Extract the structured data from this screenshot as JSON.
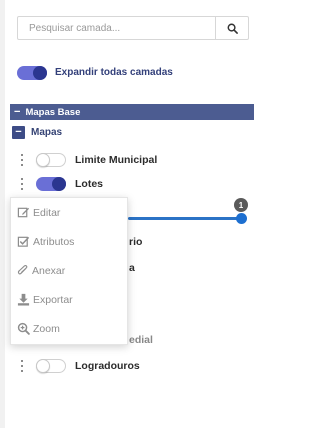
{
  "search": {
    "placeholder": "Pesquisar camada..."
  },
  "expand_all": {
    "label": "Expandir todas camadas",
    "state": "on"
  },
  "group": {
    "title": "Mapas Base",
    "toggle_symbol": "−"
  },
  "subgroup": {
    "title": "Mapas",
    "toggle_symbol": "−"
  },
  "layers": [
    {
      "label": "Limite Municipal",
      "visible": false
    },
    {
      "label": "Lotes",
      "visible": true
    },
    {
      "label": "rio",
      "visible": false
    },
    {
      "label": "a",
      "visible": false
    },
    {
      "label": "edial",
      "visible": false
    },
    {
      "label": "Logradouros",
      "visible": false
    }
  ],
  "opacity_slider": {
    "badge": "1"
  },
  "context_menu": {
    "items": [
      {
        "label": "Editar",
        "icon": "edit-icon"
      },
      {
        "label": "Atributos",
        "icon": "checkbox-icon"
      },
      {
        "label": "Anexar",
        "icon": "paperclip-icon"
      },
      {
        "label": "Exportar",
        "icon": "download-icon"
      },
      {
        "label": "Zoom",
        "icon": "zoom-icon"
      }
    ]
  },
  "colors": {
    "accent": "#4c5c91",
    "toggle_on": "#6a6fd6",
    "slider": "#1d6fd0"
  }
}
